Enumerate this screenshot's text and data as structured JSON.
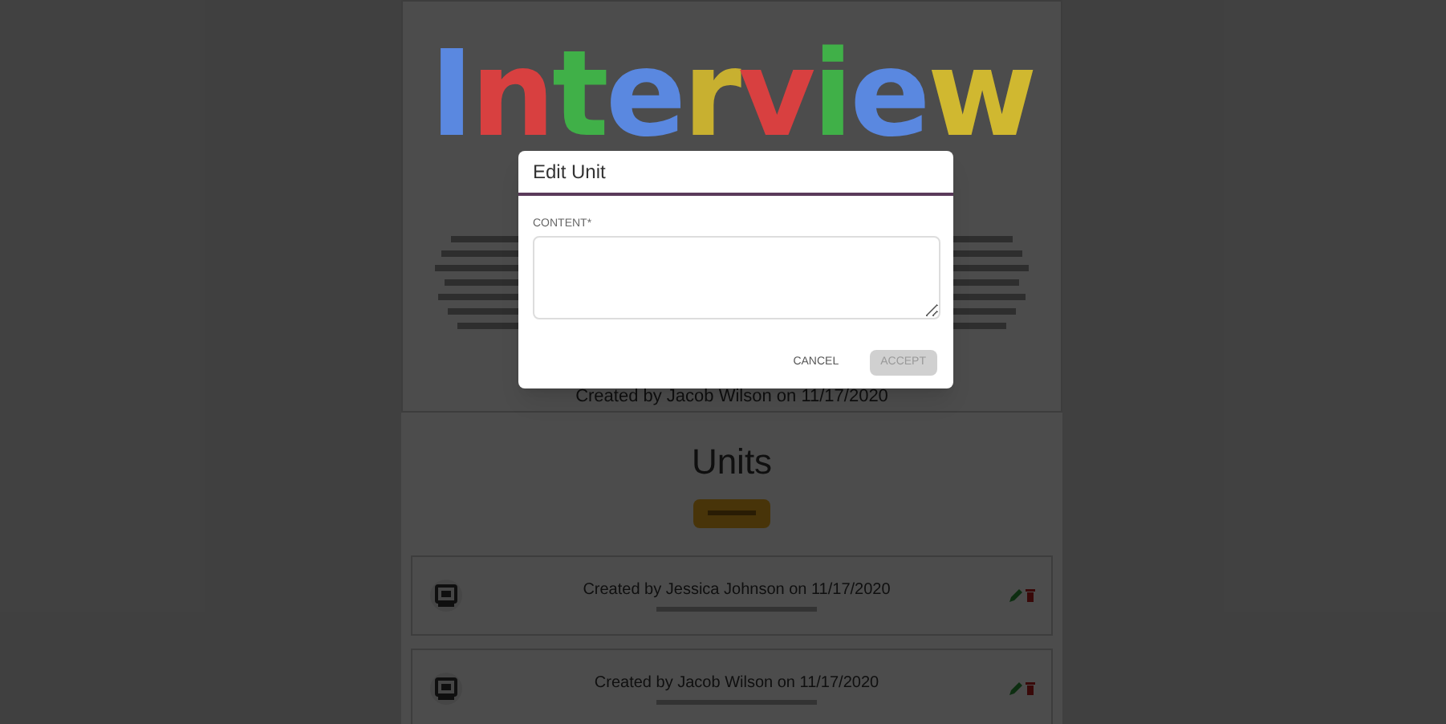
{
  "logo": {
    "letters": [
      {
        "text": "I",
        "color": "#5a88e0"
      },
      {
        "text": "n",
        "color": "#d84040"
      },
      {
        "text": "t",
        "color": "#40b048"
      },
      {
        "text": "e",
        "color": "#5a88e0"
      },
      {
        "text": "r",
        "color": "#c8b030"
      },
      {
        "text": "v",
        "color": "#d84040"
      },
      {
        "text": "i",
        "color": "#40b048"
      },
      {
        "text": "e",
        "color": "#5a88e0"
      },
      {
        "text": "w",
        "color": "#d0b830"
      }
    ]
  },
  "intro_footer": "Created by Jacob Wilson on 11/17/2020",
  "units_heading": "Units",
  "units": [
    {
      "title": "Created by Jessica Johnson on 11/17/2020"
    },
    {
      "title": "Created by Jacob Wilson on 11/17/2020"
    }
  ],
  "dialog": {
    "title": "Edit Unit",
    "field": {
      "label": "CONTENT*"
    },
    "buttons": [
      {
        "label": "CANCEL",
        "disabled": false
      },
      {
        "label": "ACCEPT",
        "disabled": true
      }
    ]
  }
}
